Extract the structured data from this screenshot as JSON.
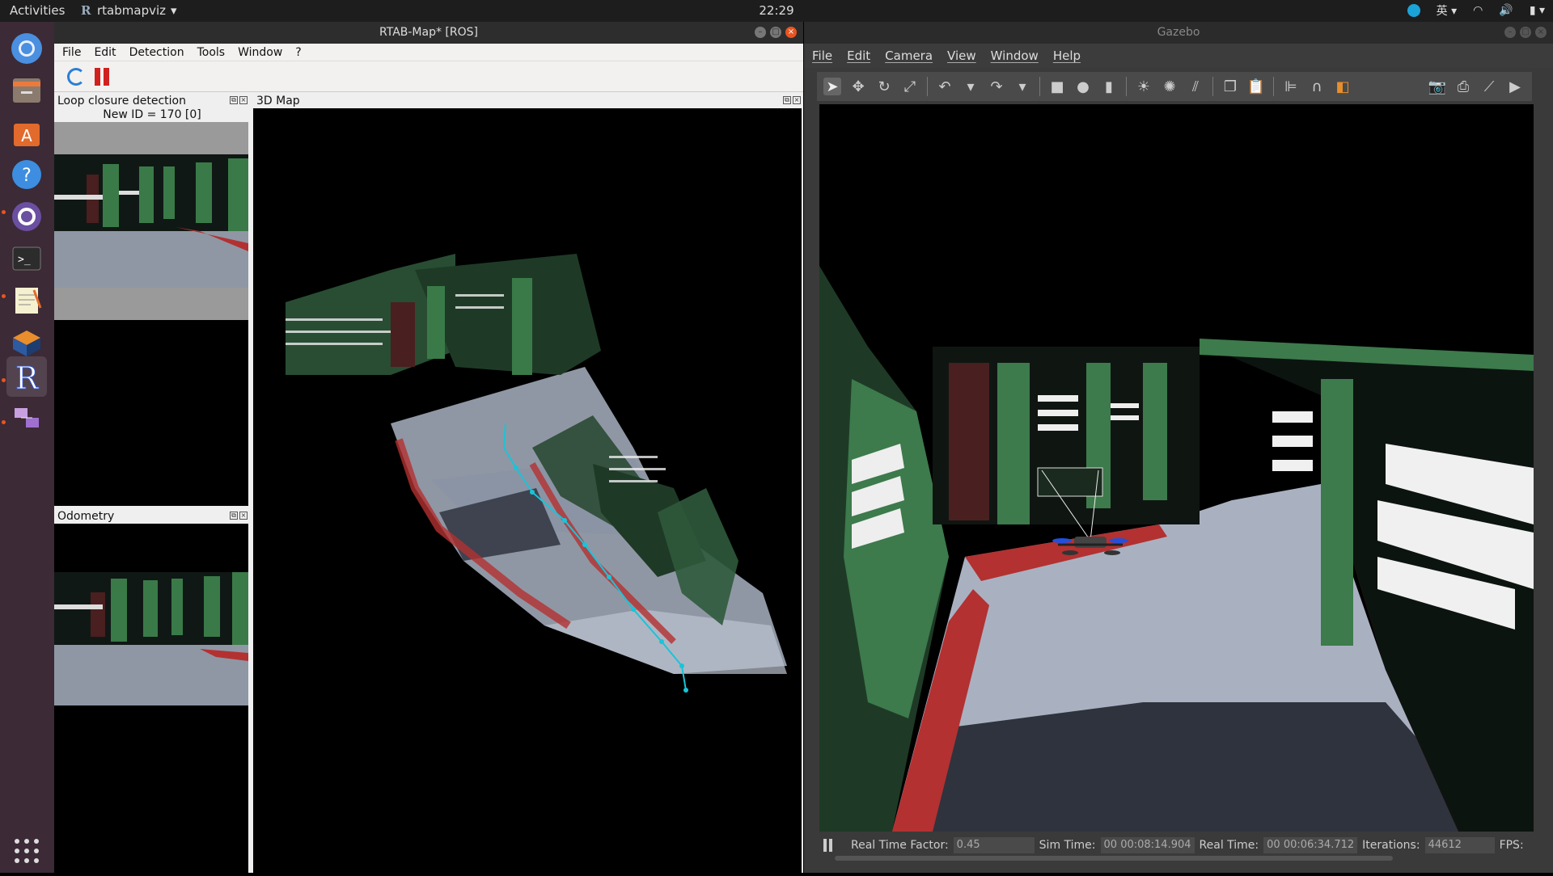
{
  "topbar": {
    "activities": "Activities",
    "app_name": "rtabmapviz",
    "clock": "22:29",
    "lang": "英"
  },
  "dock": {
    "items": [
      "chromium-icon",
      "files-icon",
      "software-center-icon",
      "help-icon",
      "qt-creator-icon",
      "terminal-icon",
      "text-editor-icon",
      "virtualbox-icon",
      "rtabmap-icon",
      "network-app-icon"
    ]
  },
  "rtab": {
    "title": "RTAB-Map* [ROS]",
    "menu": [
      "File",
      "Edit",
      "Detection",
      "Tools",
      "Window",
      "?"
    ],
    "loop_panel": {
      "title": "Loop closure detection",
      "new_id": "New ID = 170 [0]"
    },
    "odometry_panel": {
      "title": "Odometry"
    },
    "map_panel": {
      "title": "3D Map"
    }
  },
  "gazebo": {
    "title": "Gazebo",
    "menu": [
      "File",
      "Edit",
      "Camera",
      "View",
      "Window",
      "Help"
    ],
    "status": {
      "rtf_label": "Real Time Factor:",
      "rtf_value": "0.45",
      "sim_label": "Sim Time:",
      "sim_value": "00 00:08:14.904",
      "real_label": "Real Time:",
      "real_value": "00 00:06:34.712",
      "iter_label": "Iterations:",
      "iter_value": "44612",
      "fps_label": "FPS:"
    }
  },
  "colors": {
    "accent": "#e95420",
    "floor": "#a9b1c1",
    "wall": "#3d7a4c",
    "stripe": "#c03a3a",
    "trajectory": "#19c4d8"
  }
}
